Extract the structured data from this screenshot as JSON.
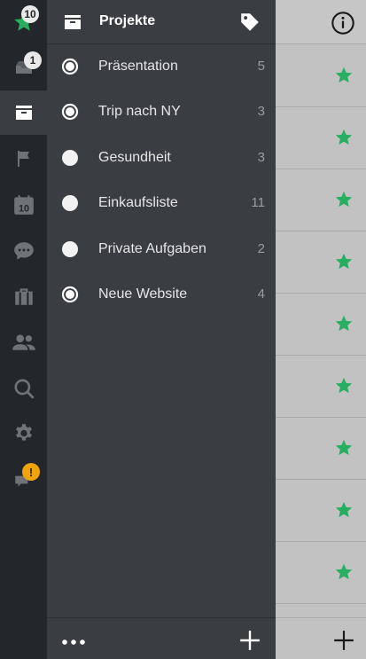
{
  "rail": {
    "items": [
      {
        "icon": "star-icon",
        "badge": "10"
      },
      {
        "icon": "inbox-icon",
        "badge": "1"
      },
      {
        "icon": "projects-icon"
      },
      {
        "icon": "flag-icon"
      },
      {
        "icon": "calendar-icon",
        "label": "10"
      },
      {
        "icon": "chat-icon"
      },
      {
        "icon": "briefcase-icon"
      },
      {
        "icon": "people-icon"
      },
      {
        "icon": "search-icon"
      },
      {
        "icon": "gear-icon"
      },
      {
        "icon": "feedback-icon",
        "badge": "!"
      }
    ],
    "star_color": "#27ae60",
    "warning_color": "#f0a30a"
  },
  "panel": {
    "title": "Projekte",
    "projects": [
      {
        "name": "Präsentation",
        "count": "5",
        "radio": "selected"
      },
      {
        "name": "Trip nach NY",
        "count": "3",
        "radio": "selected"
      },
      {
        "name": "Gesundheit",
        "count": "3",
        "radio": "empty"
      },
      {
        "name": "Einkaufsliste",
        "count": "11",
        "radio": "empty"
      },
      {
        "name": "Private Aufgaben",
        "count": "2",
        "radio": "empty"
      },
      {
        "name": "Neue Website",
        "count": "4",
        "radio": "selected"
      }
    ]
  },
  "right": {
    "star_color": "#27ae60"
  }
}
